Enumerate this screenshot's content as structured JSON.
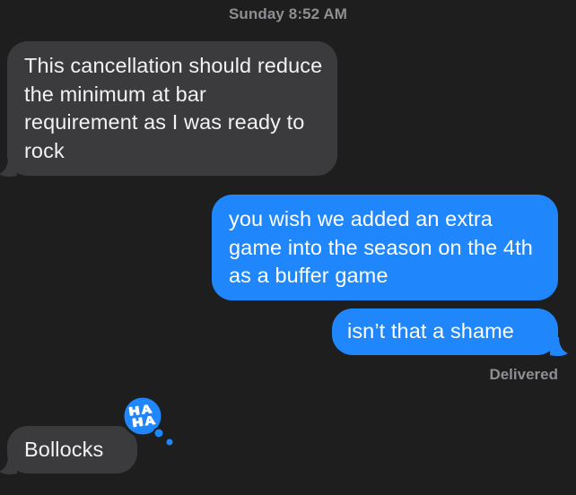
{
  "conversation": {
    "timestamp": "Sunday 8:52 AM",
    "messages": [
      {
        "direction": "received",
        "text": "This cancellation should reduce the minimum at bar requirement as I was ready to rock"
      },
      {
        "direction": "sent",
        "text": "you wish we added an extra game into the season on the 4th as a buffer game"
      },
      {
        "direction": "sent",
        "text": "isn’t that a shame"
      },
      {
        "direction": "received",
        "text": "Bollocks",
        "tapback": {
          "icon": "haha-tapback-icon",
          "text": "HA HA",
          "color": "#1f87fb"
        }
      }
    ],
    "delivery_status": "Delivered"
  },
  "colors": {
    "background": "#1e1e1e",
    "received_bubble": "#3b3b3d",
    "sent_bubble": "#1f87fb",
    "meta_text": "#8e8e93"
  }
}
